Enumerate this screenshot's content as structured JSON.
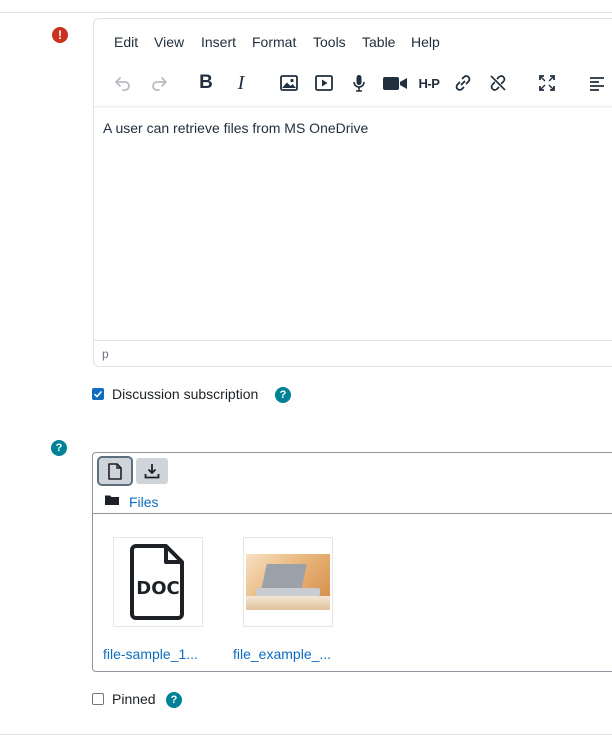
{
  "editor": {
    "menu": [
      "Edit",
      "View",
      "Insert",
      "Format",
      "Tools",
      "Table",
      "Help"
    ],
    "toolbar_icons": [
      "undo-icon",
      "redo-icon",
      "bold-icon",
      "italic-icon",
      "image-icon",
      "media-icon",
      "microphone-icon",
      "video-camera-icon",
      "h5p-icon",
      "link-icon",
      "unlink-icon",
      "fullscreen-icon",
      "align-left-icon"
    ],
    "content": "A user can retrieve files from MS OneDrive",
    "status_path": "p"
  },
  "subscription": {
    "label": "Discussion subscription",
    "checked": true
  },
  "filemanager": {
    "folder_label": "Files",
    "files": [
      {
        "name": "file-sample_1...",
        "icon": "doc-file-icon",
        "type_text": "DOC"
      },
      {
        "name": "file_example_...",
        "icon": "image-thumbnail"
      }
    ]
  },
  "pinned": {
    "label": "Pinned",
    "checked": false
  },
  "colors": {
    "accent": "#0f6cbf",
    "help": "#008196",
    "error": "#ca3120"
  }
}
